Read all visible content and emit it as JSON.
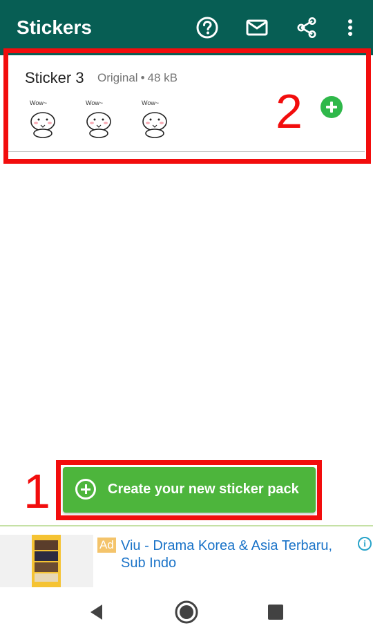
{
  "appbar": {
    "title": "Stickers",
    "background": "#075e54",
    "icons": [
      "help-icon",
      "mail-icon",
      "share-icon",
      "more-vert-icon"
    ]
  },
  "pack": {
    "name": "Sticker 3",
    "type": "Original",
    "separator": "•",
    "size": "48 kB",
    "sticker_caption": "Wow~",
    "sticker_count_shown": 3
  },
  "annotations": {
    "label_1": "1",
    "label_2": "2",
    "color": "#f20d0d"
  },
  "create_button": {
    "label": "Create your new sticker pack",
    "color": "#4db53c"
  },
  "ad": {
    "badge": "Ad",
    "title": "Viu - Drama Korea & Asia Terbaru, Sub Indo",
    "info": "i",
    "link_color": "#1a73c8"
  },
  "navbar": {
    "icons": [
      "back-icon",
      "home-icon",
      "recents-icon"
    ]
  }
}
